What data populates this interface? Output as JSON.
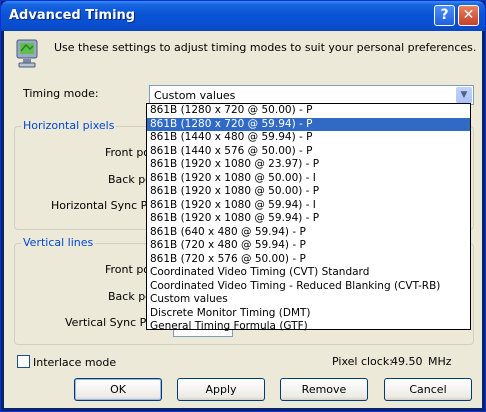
{
  "window": {
    "title": "Advanced Timing",
    "help_glyph": "?",
    "close_glyph": "✕"
  },
  "description": "Use these settings to adjust timing modes to suit your personal preferences.",
  "timing_mode": {
    "label": "Timing mode:",
    "value": "Custom values"
  },
  "horizontal": {
    "title": "Horizontal pixels",
    "front_porch": "Front po",
    "back_porch": "Back po",
    "sync_polarity": "Horizontal Sync Pola"
  },
  "vertical": {
    "title": "Vertical lines",
    "front_porch": "Front po",
    "back_porch": "Back po",
    "sync_polarity": "Vertical Sync Pola"
  },
  "interlace": {
    "label": "Interlace mode",
    "checked": false
  },
  "pixel_clock": {
    "label": "Pixel clock:",
    "value": "49.50",
    "unit": "MHz"
  },
  "buttons": {
    "ok": "OK",
    "apply": "Apply",
    "remove": "Remove",
    "cancel": "Cancel"
  },
  "dropdown": {
    "selected_index": 1,
    "options": [
      "861B (1280 x 720 @ 50.00) - P",
      "861B (1280 x 720 @ 59.94) - P",
      "861B (1440 x 480 @ 59.94) - P",
      "861B (1440 x 576 @ 50.00) - P",
      "861B (1920 x 1080 @ 23.97) - P",
      "861B (1920 x 1080 @ 50.00) - I",
      "861B (1920 x 1080 @ 50.00) - P",
      "861B (1920 x 1080 @ 59.94) - I",
      "861B (1920 x 1080 @ 59.94) - P",
      "861B (640 x 480 @ 59.94) - P",
      "861B (720 x 480 @ 59.94) - P",
      "861B (720 x 576 @ 50.00) - P",
      "Coordinated Video Timing (CVT) Standard",
      "Coordinated Video Timing - Reduced Blanking (CVT-RB)",
      "Custom values",
      "Discrete Monitor Timing (DMT)",
      "General Timing Formula (GTF)"
    ]
  },
  "colors": {
    "titlebar": "#0a53d6",
    "selection": "#316ac5",
    "group_title": "#0046d5",
    "face": "#ece9d8"
  },
  "icons": {
    "app": "monitor-icon",
    "combo_arrow": "chevron-down-icon"
  }
}
